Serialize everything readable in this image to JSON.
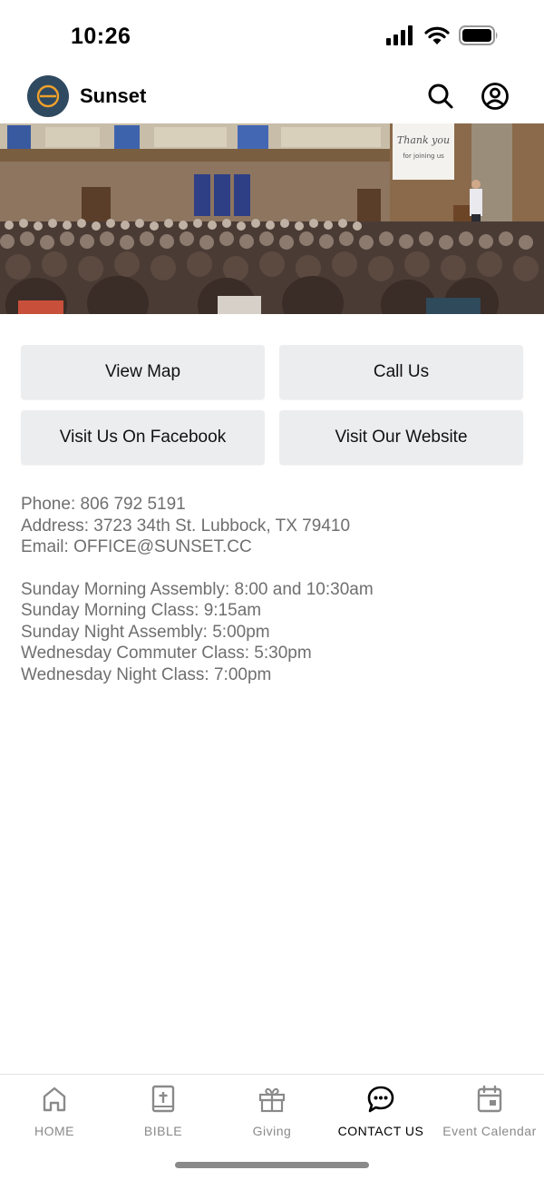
{
  "status_bar": {
    "time": "10:26",
    "icons": [
      "cellular-signal-icon",
      "wifi-icon",
      "battery-icon"
    ]
  },
  "header": {
    "title": "Sunset",
    "logo_icon": "church-logo-icon",
    "actions": [
      "search-icon",
      "profile-icon"
    ],
    "logo_bg": "#2f4960",
    "logo_accent": "#f0a12b"
  },
  "hero": {
    "image": "church-assembly-photo",
    "banner_text": "Thank you for joining us"
  },
  "buttons": {
    "view_map": "View Map",
    "call_us": "Call Us",
    "facebook": "Visit Us On Facebook",
    "website": "Visit Our Website"
  },
  "contact": {
    "phone": "Phone: 806 792 5191",
    "address": "Address: 3723 34th St. Lubbock, TX 79410",
    "email": "Email: OFFICE@SUNSET.CC"
  },
  "schedule": [
    "Sunday Morning Assembly: 8:00 and 10:30am",
    "Sunday Morning Class: 9:15am",
    "Sunday Night Assembly: 5:00pm",
    "Wednesday Commuter Class: 5:30pm",
    "Wednesday Night Class: 7:00pm"
  ],
  "tabs": [
    {
      "label": "HOME",
      "icon": "home-icon"
    },
    {
      "label": "BIBLE",
      "icon": "bible-icon"
    },
    {
      "label": "Giving",
      "icon": "gift-icon"
    },
    {
      "label": "CONTACT US",
      "icon": "chat-bubble-icon",
      "active": true
    },
    {
      "label": "Event Calendar",
      "icon": "calendar-icon"
    }
  ]
}
